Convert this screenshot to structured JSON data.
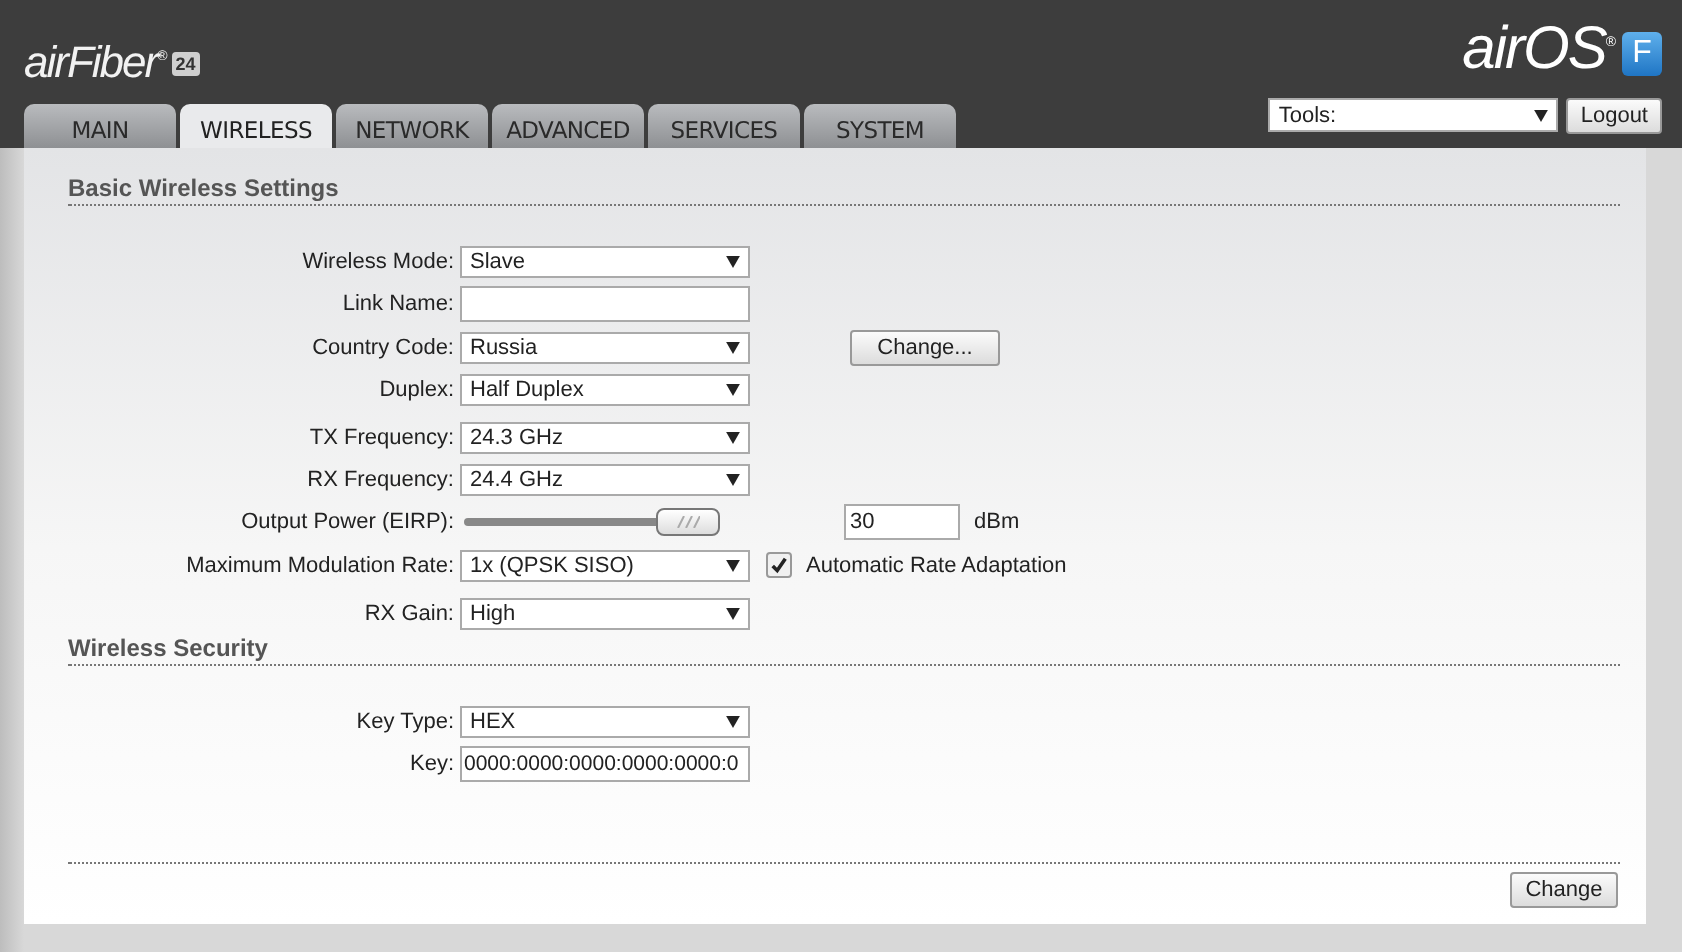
{
  "header": {
    "product_logo": {
      "name": "airFiber",
      "mark": "®",
      "badge": "24"
    },
    "os_logo": {
      "name": "airOS",
      "mark": "®",
      "badge": "F"
    },
    "tools": {
      "value": "Tools:"
    },
    "logout": "Logout"
  },
  "tabs": [
    {
      "label": "MAIN",
      "selected": false
    },
    {
      "label": "WIRELESS",
      "selected": true
    },
    {
      "label": "NETWORK",
      "selected": false
    },
    {
      "label": "ADVANCED",
      "selected": false
    },
    {
      "label": "SERVICES",
      "selected": false
    },
    {
      "label": "SYSTEM",
      "selected": false
    }
  ],
  "sections": [
    {
      "title": "Basic Wireless Settings",
      "groups": [
        [
          {
            "kind": "select",
            "label": "Wireless Mode:",
            "value": "Slave"
          },
          {
            "kind": "text",
            "label": "Link Name:"
          },
          {
            "kind": "select",
            "label": "Country Code:",
            "value": "Russia",
            "button": "Change..."
          },
          {
            "kind": "select",
            "label": "Duplex:",
            "value": "Half Duplex"
          }
        ],
        [
          {
            "kind": "select",
            "label": "TX Frequency:",
            "value": "24.3 GHz"
          },
          {
            "kind": "select",
            "label": "RX Frequency:",
            "value": "24.4 GHz"
          },
          {
            "kind": "slider",
            "label": "Output Power (EIRP):",
            "level": 1,
            "value": "30",
            "unit": "dBm"
          },
          {
            "kind": "select",
            "label": "Maximum Modulation Rate:",
            "value": "1x (QPSK SISO)",
            "checkbox": {
              "label": "Automatic Rate Adaptation",
              "checked": true
            }
          }
        ],
        [
          {
            "kind": "select",
            "label": "RX Gain:",
            "value": "High"
          }
        ]
      ]
    },
    {
      "title": "Wireless Security",
      "groups": [
        [
          {
            "kind": "select",
            "label": "Key Type:",
            "value": "HEX"
          },
          {
            "kind": "text",
            "label": "Key:",
            "value": "0000:0000:0000:0000:0000:0"
          }
        ]
      ]
    }
  ],
  "footer": {
    "button": "Change"
  }
}
